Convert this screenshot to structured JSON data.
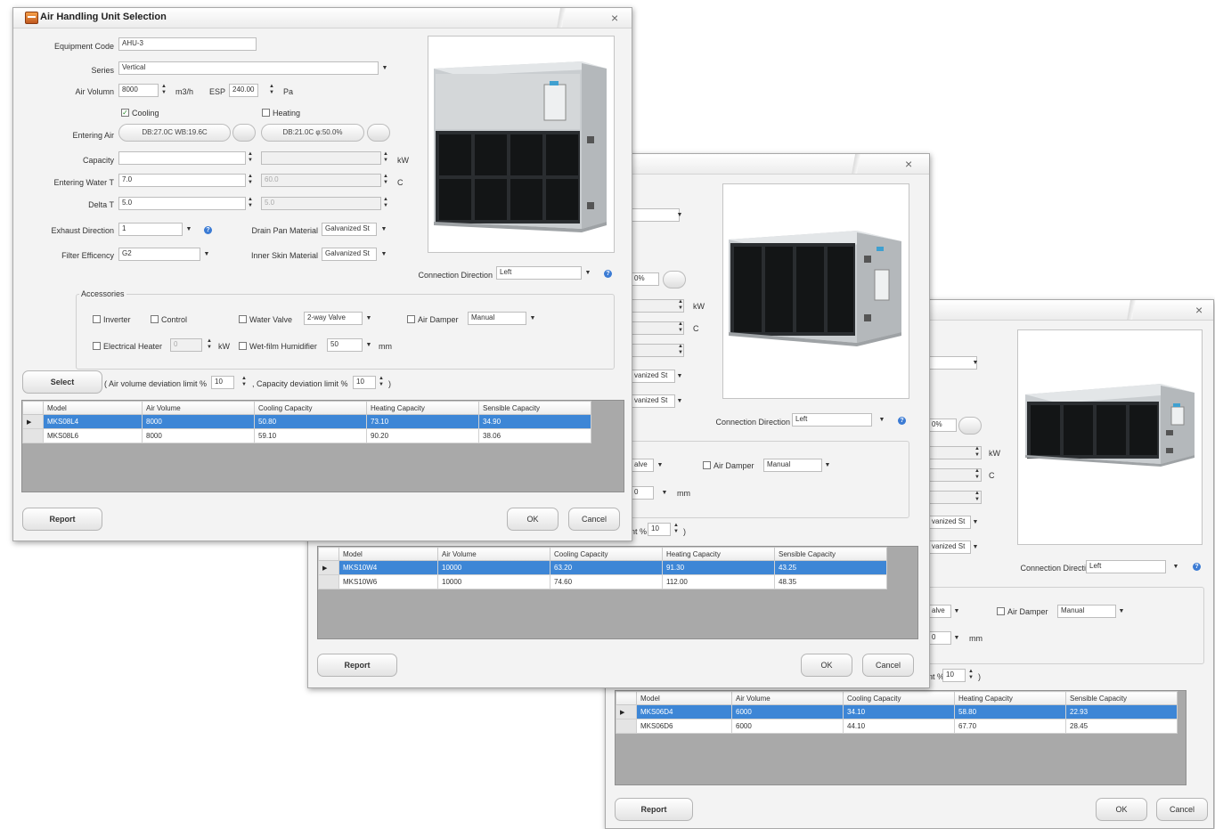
{
  "dialog1": {
    "title": "Air Handling Unit Selection",
    "close_label": "×",
    "labels": {
      "equipment_code": "Equipment Code",
      "series": "Series",
      "air_volume": "Air Volumn",
      "air_volume_unit": "m3/h",
      "esp": "ESP",
      "esp_unit": "Pa",
      "cooling": "Cooling",
      "heating": "Heating",
      "entering_air": "Entering Air",
      "capacity": "Capacity",
      "capacity_unit": "kW",
      "entering_water_t": "Entering Water T",
      "temp_unit": "C",
      "delta_t": "Delta T",
      "exhaust_direction": "Exhaust Direction",
      "drain_pan_material": "Drain Pan Material",
      "filter_efficiency": "Filter Efficency",
      "inner_skin_material": "Inner Skin Material",
      "connection_direction": "Connection Direction"
    },
    "values": {
      "equipment_code": "AHU-3",
      "series": "Vertical",
      "air_volume": "8000",
      "esp": "240.00",
      "entering_air_cooling": "DB:27.0C WB:19.6C",
      "entering_air_heating": "DB:21.0C φ:50.0%",
      "capacity": "",
      "capacity_heating": "",
      "entering_water_t": "7.0",
      "entering_water_t_heating": "60.0",
      "delta_t": "5.0",
      "delta_t_heating": "5.0",
      "exhaust_direction": "1",
      "drain_pan_material": "Galvanized St",
      "filter_efficiency": "G2",
      "inner_skin_material": "Galvanized St",
      "connection_direction": "Left"
    },
    "accessories": {
      "title": "Accessories",
      "inverter": "Inverter",
      "control": "Control",
      "water_valve": "Water Valve",
      "water_valve_type": "2-way Valve",
      "air_damper": "Air Damper",
      "air_damper_type": "Manual",
      "electrical_heater": "Electrical Heater",
      "electrical_heater_value": "0",
      "electrical_heater_unit": "kW",
      "wet_film_humidifier": "Wet-film Humidifier",
      "humidifier_value": "50",
      "humidifier_unit": "mm"
    },
    "select_row": {
      "select_button": "Select",
      "air_volume_limit_label": "( Air volume deviation limit %",
      "air_volume_limit": "10",
      "capacity_limit_label": ", Capacity deviation limit %",
      "capacity_limit": "10",
      "closing_paren": ")"
    },
    "table": {
      "headers": [
        "Model",
        "Air Volume",
        "Cooling Capacity",
        "Heating Capacity",
        "Sensible Capacity"
      ],
      "rows": [
        {
          "model": "MKS08L4",
          "air_volume": "8000",
          "cooling": "50.80",
          "heating": "73.10",
          "sensible": "34.90"
        },
        {
          "model": "MKS08L6",
          "air_volume": "8000",
          "cooling": "59.10",
          "heating": "90.20",
          "sensible": "38.06"
        }
      ]
    },
    "buttons": {
      "report": "Report",
      "ok": "OK",
      "cancel": "Cancel"
    }
  },
  "dialog2": {
    "close_label": "×",
    "values": {
      "entering_air_heating": "0%",
      "capacity_unit": "kW",
      "temp_unit": "C",
      "drain_pan_material": "vanized St",
      "inner_skin_material": "vanized St",
      "connection_direction_label": "Connection Direction",
      "connection_direction": "Left",
      "water_valve_type": "alve",
      "air_damper": "Air Damper",
      "air_damper_type": "Manual",
      "humidifier_value": "0",
      "humidifier_unit": "mm",
      "capacity_limit_label": "nt %",
      "capacity_limit": "10",
      "closing_paren": ")"
    },
    "table": {
      "headers": [
        "Model",
        "Air Volume",
        "Cooling Capacity",
        "Heating Capacity",
        "Sensible Capacity"
      ],
      "rows": [
        {
          "model": "MKS10W4",
          "air_volume": "10000",
          "cooling": "63.20",
          "heating": "91.30",
          "sensible": "43.25"
        },
        {
          "model": "MKS10W6",
          "air_volume": "10000",
          "cooling": "74.60",
          "heating": "112.00",
          "sensible": "48.35"
        }
      ]
    },
    "buttons": {
      "report": "Report",
      "ok": "OK",
      "cancel": "Cancel"
    }
  },
  "dialog3": {
    "close_label": "×",
    "values": {
      "entering_air_heating": "0%",
      "capacity_unit": "kW",
      "temp_unit": "C",
      "drain_pan_material": "vanized St",
      "inner_skin_material": "vanized St",
      "connection_direction_label": "Connection Direction",
      "connection_direction": "Left",
      "water_valve_type": "alve",
      "air_damper": "Air Damper",
      "air_damper_type": "Manual",
      "humidifier_value": "0",
      "humidifier_unit": "mm",
      "capacity_limit_label": "nt %",
      "capacity_limit": "10",
      "closing_paren": ")"
    },
    "table": {
      "headers": [
        "Model",
        "Air Volume",
        "Cooling Capacity",
        "Heating Capacity",
        "Sensible Capacity"
      ],
      "rows": [
        {
          "model": "MKS06D4",
          "air_volume": "6000",
          "cooling": "34.10",
          "heating": "58.80",
          "sensible": "22.93"
        },
        {
          "model": "MKS06D6",
          "air_volume": "6000",
          "cooling": "44.10",
          "heating": "67.70",
          "sensible": "28.45"
        }
      ]
    },
    "buttons": {
      "report": "Report",
      "ok": "OK",
      "cancel": "Cancel"
    }
  },
  "colors": {
    "selection": "#3d86d6",
    "window_bg": "#f3f3f3",
    "grid_bg": "#a9a9a9",
    "help_icon": "#3b7bd4"
  },
  "icons": {
    "app": "app-icon",
    "help": "help-icon",
    "row_pointer": "row-pointer-icon"
  }
}
